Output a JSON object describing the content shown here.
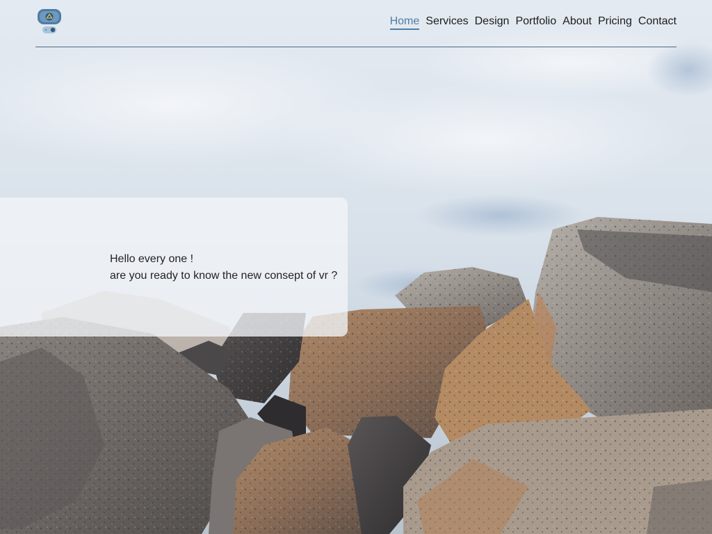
{
  "nav": {
    "items": [
      {
        "label": "Home",
        "active": true
      },
      {
        "label": "Services",
        "active": false
      },
      {
        "label": "Design",
        "active": false
      },
      {
        "label": "Portfolio",
        "active": false
      },
      {
        "label": "About",
        "active": false
      },
      {
        "label": "Pricing",
        "active": false
      },
      {
        "label": "Contact",
        "active": false
      }
    ]
  },
  "logo": {
    "icon": "vr-headset-icon"
  },
  "hero": {
    "line1": "Hello every one !",
    "line2": "are you ready to know the new consept of vr ?"
  },
  "colors": {
    "accent": "#4e7da3",
    "divider": "#4a6a86",
    "text": "#1c1c1c"
  },
  "background": {
    "icon": "rocks-photo"
  }
}
